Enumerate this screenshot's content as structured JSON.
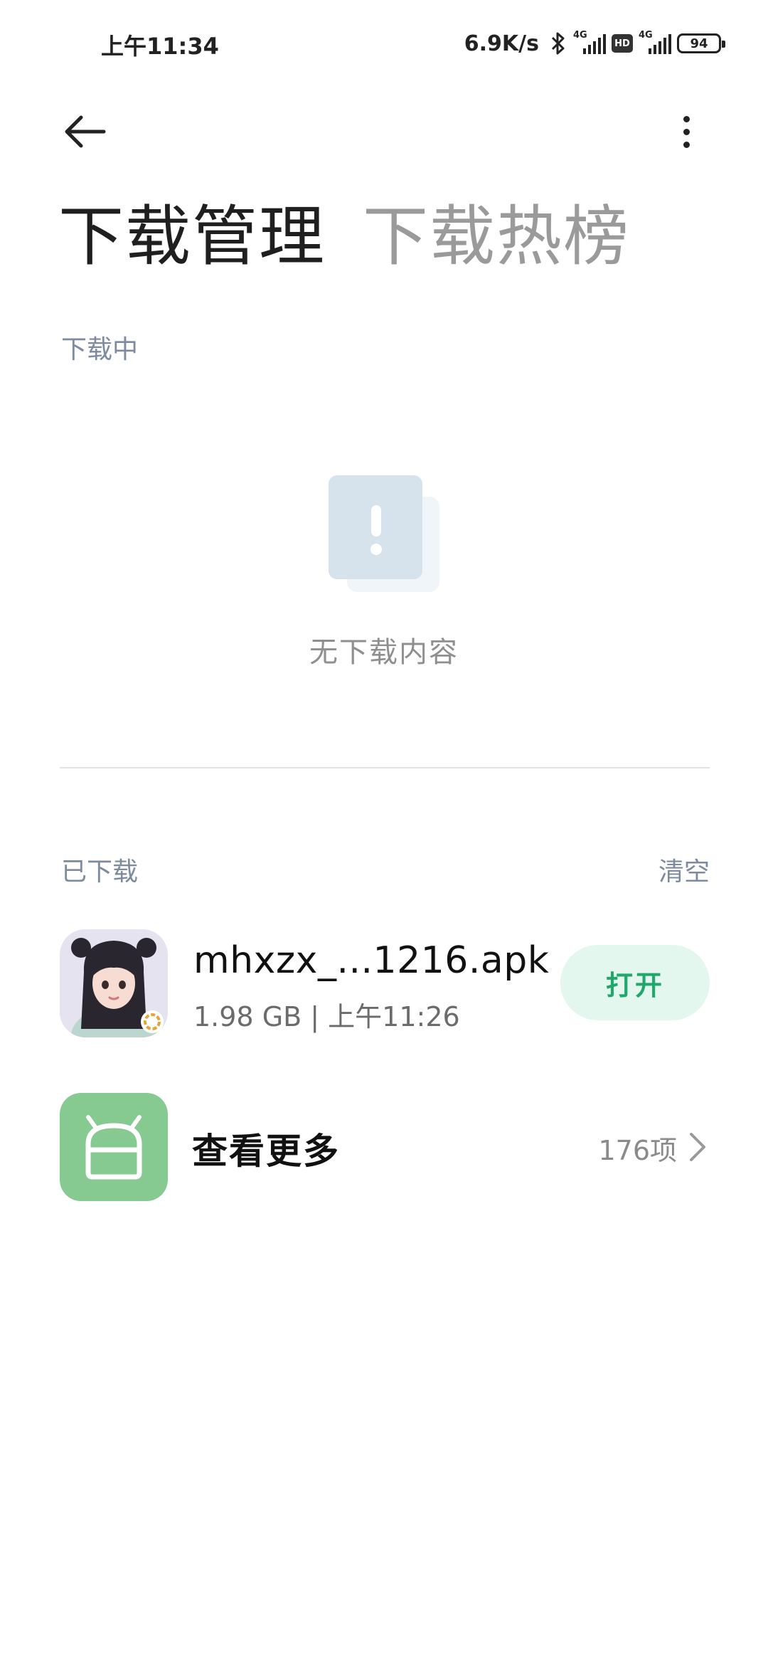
{
  "status_bar": {
    "time": "上午11:34",
    "net_speed": "6.9K/s",
    "network_tag_1": "4G",
    "network_tag_2": "4G",
    "hd_label": "HD",
    "battery": "94"
  },
  "header": {
    "tabs": [
      {
        "label": "下载管理",
        "active": true
      },
      {
        "label": "下载热榜",
        "active": false
      }
    ]
  },
  "downloading": {
    "section_label": "下载中",
    "empty_text": "无下载内容"
  },
  "downloaded": {
    "section_label": "已下载",
    "clear_label": "清空",
    "items": [
      {
        "file_name": "mhxzx_...1216.apk",
        "meta": "1.98 GB | 上午11:26",
        "action_label": "打开"
      }
    ]
  },
  "see_more": {
    "label": "查看更多",
    "count": "176项"
  },
  "colors": {
    "accent_green": "#1fa869",
    "open_button_bg": "#e4f7ee",
    "folder_icon_bg": "#86c991",
    "section_label": "#7d8aa0"
  }
}
